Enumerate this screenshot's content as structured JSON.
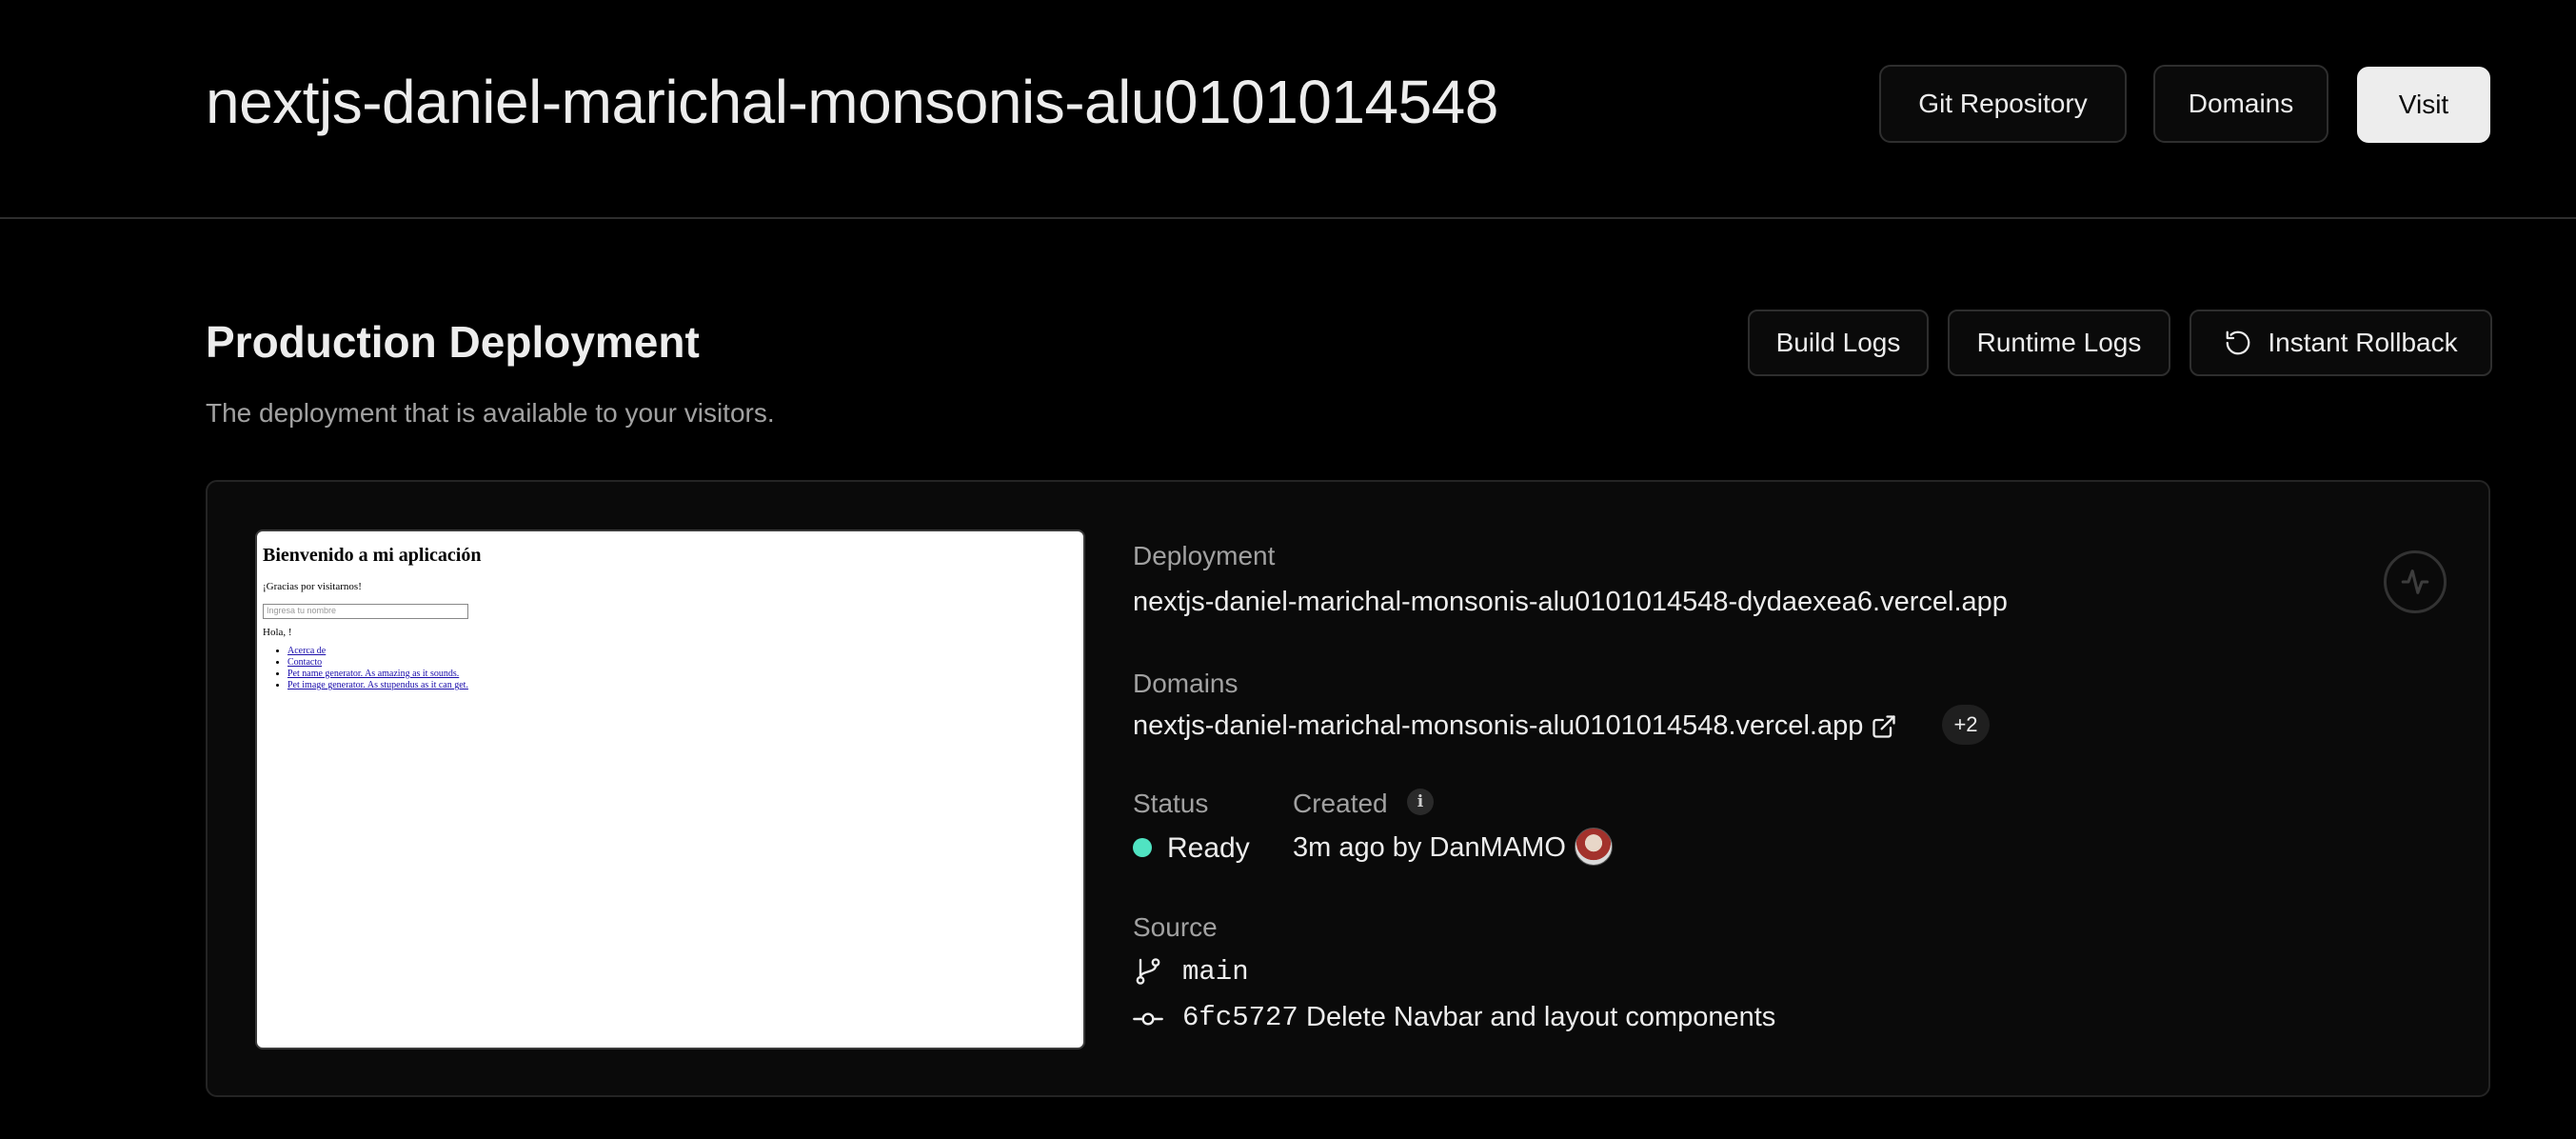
{
  "header": {
    "project_title": "nextjs-daniel-marichal-monsonis-alu0101014548",
    "git_repository_label": "Git Repository",
    "domains_label": "Domains",
    "visit_label": "Visit"
  },
  "production": {
    "title": "Production Deployment",
    "subtitle": "The deployment that is available to your visitors.",
    "build_logs_label": "Build Logs",
    "runtime_logs_label": "Runtime Logs",
    "instant_rollback_label": "Instant Rollback"
  },
  "preview": {
    "heading": "Bienvenido a mi aplicación",
    "thanks": "¡Gracias por visitarnos!",
    "input_placeholder": "Ingresa tu nombre",
    "greeting": "Hola, !",
    "links": [
      "Acerca de",
      "Contacto",
      "Pet name generator. As amazing as it sounds.",
      "Pet image generator. As stupendus as it can get."
    ]
  },
  "deployment": {
    "deployment_label": "Deployment",
    "deployment_url": "nextjs-daniel-marichal-monsonis-alu0101014548-dydaexea6.vercel.app",
    "domains_label": "Domains",
    "domain_url": "nextjs-daniel-marichal-monsonis-alu0101014548.vercel.app",
    "more_domains": "+2",
    "status_label": "Status",
    "status_value": "Ready",
    "status_color": "#50e3c2",
    "created_label": "Created",
    "created_value": "3m ago by DanMAMO",
    "source_label": "Source",
    "branch": "main",
    "commit_hash": "6fc5727",
    "commit_message": "Delete Navbar and layout components"
  }
}
